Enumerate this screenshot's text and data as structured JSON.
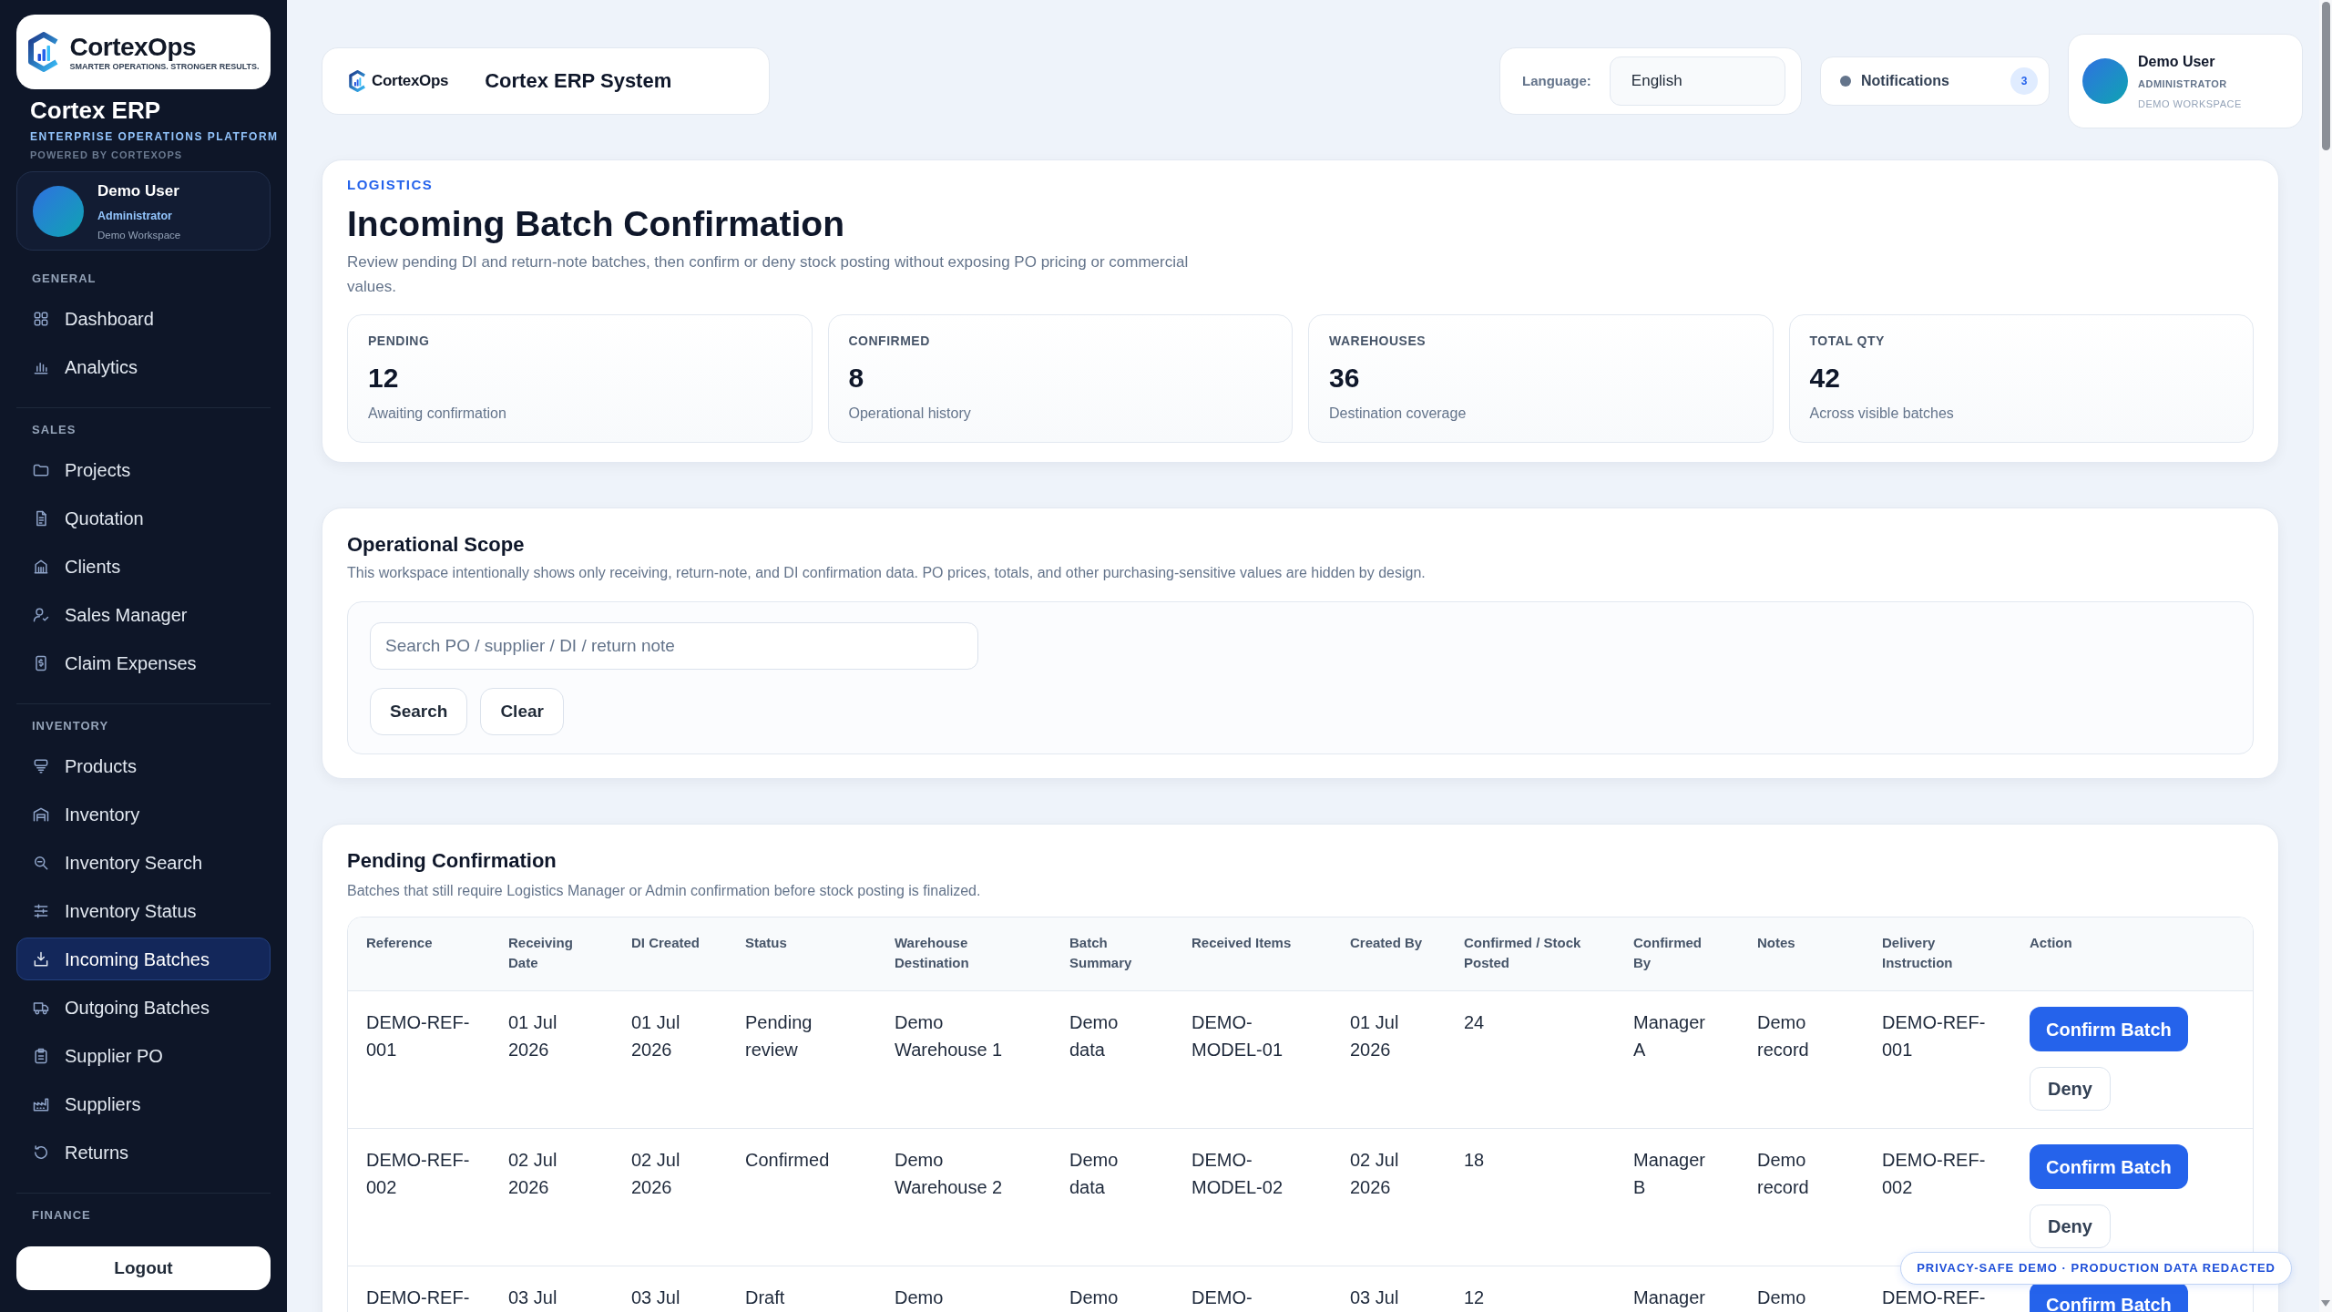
{
  "sidebar": {
    "logo": {
      "name": "CortexOps",
      "tagline": "SMARTER OPERATIONS. STRONGER RESULTS."
    },
    "app_title": "Cortex ERP",
    "app_subtitle": "ENTERPRISE OPERATIONS PLATFORM",
    "powered_by": "POWERED BY CORTEXOPS",
    "user": {
      "name": "Demo User",
      "role": "Administrator",
      "workspace": "Demo Workspace"
    },
    "sections": [
      {
        "label": "GENERAL",
        "items": [
          {
            "label": "Dashboard",
            "selected": false
          },
          {
            "label": "Analytics",
            "selected": false
          }
        ]
      },
      {
        "label": "SALES",
        "items": [
          {
            "label": "Projects",
            "selected": false
          },
          {
            "label": "Quotation",
            "selected": false
          },
          {
            "label": "Clients",
            "selected": false
          },
          {
            "label": "Sales Manager",
            "selected": false
          },
          {
            "label": "Claim Expenses",
            "selected": false
          }
        ]
      },
      {
        "label": "INVENTORY",
        "items": [
          {
            "label": "Products",
            "selected": false
          },
          {
            "label": "Inventory",
            "selected": false
          },
          {
            "label": "Inventory Search",
            "selected": false
          },
          {
            "label": "Inventory Status",
            "selected": false
          },
          {
            "label": "Incoming Batches",
            "selected": true
          },
          {
            "label": "Outgoing Batches",
            "selected": false
          },
          {
            "label": "Supplier PO",
            "selected": false
          },
          {
            "label": "Suppliers",
            "selected": false
          },
          {
            "label": "Returns",
            "selected": false
          }
        ]
      },
      {
        "label": "FINANCE"
      }
    ],
    "logout": "Logout"
  },
  "header": {
    "brand": {
      "logo": "CortexOps",
      "title": "Cortex ERP System"
    },
    "language": {
      "label": "Language:",
      "value": "English"
    },
    "notifications": {
      "label": "Notifications",
      "count": "3"
    },
    "user": {
      "name": "Demo User",
      "role": "ADMINISTRATOR",
      "workspace": "DEMO WORKSPACE"
    }
  },
  "page": {
    "eyebrow": "LOGISTICS",
    "title": "Incoming Batch Confirmation",
    "description": "Review pending DI and return-note batches, then confirm or deny stock posting without exposing PO pricing or commercial values.",
    "stats": [
      {
        "label": "PENDING",
        "value": "12",
        "caption": "Awaiting confirmation"
      },
      {
        "label": "CONFIRMED",
        "value": "8",
        "caption": "Operational history"
      },
      {
        "label": "WAREHOUSES",
        "value": "36",
        "caption": "Destination coverage"
      },
      {
        "label": "TOTAL QTY",
        "value": "42",
        "caption": "Across visible batches"
      }
    ]
  },
  "scope": {
    "title": "Operational Scope",
    "description": "This workspace intentionally shows only receiving, return-note, and DI confirmation data. PO prices, totals, and other purchasing-sensitive values are hidden by design.",
    "search": {
      "placeholder": "Search PO / supplier / DI / return note"
    },
    "buttons": [
      "Search",
      "Clear"
    ]
  },
  "pending": {
    "title": "Pending Confirmation",
    "description": "Batches that still require Logistics Manager or Admin confirmation before stock posting is finalized.",
    "table": {
      "columns": [
        "Reference",
        "Receiving Date",
        "DI Created",
        "Status",
        "Warehouse Destination",
        "Batch Summary",
        "Received Items",
        "Created By",
        "Confirmed / Stock Posted",
        "Confirmed By",
        "Notes",
        "Delivery Instruction",
        "Action"
      ],
      "rows": [
        {
          "cells": [
            "DEMO-REF-001",
            "01 Jul 2026",
            "01 Jul 2026",
            "Pending review",
            "Demo Warehouse 1",
            "Demo data",
            "DEMO-MODEL-01",
            "01 Jul 2026",
            "24",
            "Manager A",
            "Demo record",
            "DEMO-REF-001"
          ],
          "actions": [
            {
              "label": "Confirm Batch",
              "kind": "confirm"
            },
            {
              "label": "Deny",
              "kind": "deny"
            }
          ]
        },
        {
          "cells": [
            "DEMO-REF-002",
            "02 Jul 2026",
            "02 Jul 2026",
            "Confirmed",
            "Demo Warehouse 2",
            "Demo data",
            "DEMO-MODEL-02",
            "02 Jul 2026",
            "18",
            "Manager B",
            "Demo record",
            "DEMO-REF-002"
          ],
          "actions": [
            {
              "label": "Confirm Batch",
              "kind": "confirm"
            },
            {
              "label": "Deny",
              "kind": "deny"
            }
          ]
        },
        {
          "cells": [
            "DEMO-REF-",
            "03 Jul",
            "03 Jul",
            "Draft",
            "Demo",
            "Demo",
            "DEMO-",
            "03 Jul",
            "12",
            "Manager",
            "Demo",
            "DEMO-REF-"
          ],
          "actions": [
            {
              "label": "Confirm Batch",
              "kind": "confirm"
            }
          ]
        }
      ]
    }
  },
  "privacy_badge": "PRIVACY-SAFE DEMO · PRODUCTION DATA REDACTED"
}
